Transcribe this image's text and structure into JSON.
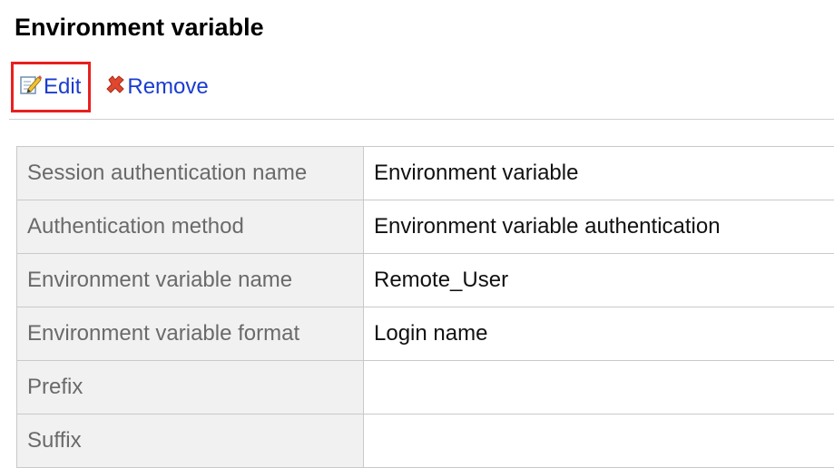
{
  "page": {
    "title": "Environment variable"
  },
  "toolbar": {
    "edit_label": "Edit",
    "edit_icon": "edit-icon",
    "remove_label": "Remove",
    "remove_icon": "remove-x-icon",
    "highlight_color": "#e8201e",
    "link_color": "#1a3cd1"
  },
  "details": {
    "rows": [
      {
        "label": "Session authentication name",
        "value": "Environment variable"
      },
      {
        "label": "Authentication method",
        "value": "Environment variable authentication"
      },
      {
        "label": "Environment variable name",
        "value": "Remote_User"
      },
      {
        "label": "Environment variable format",
        "value": "Login name"
      },
      {
        "label": "Prefix",
        "value": ""
      },
      {
        "label": "Suffix",
        "value": ""
      }
    ]
  }
}
